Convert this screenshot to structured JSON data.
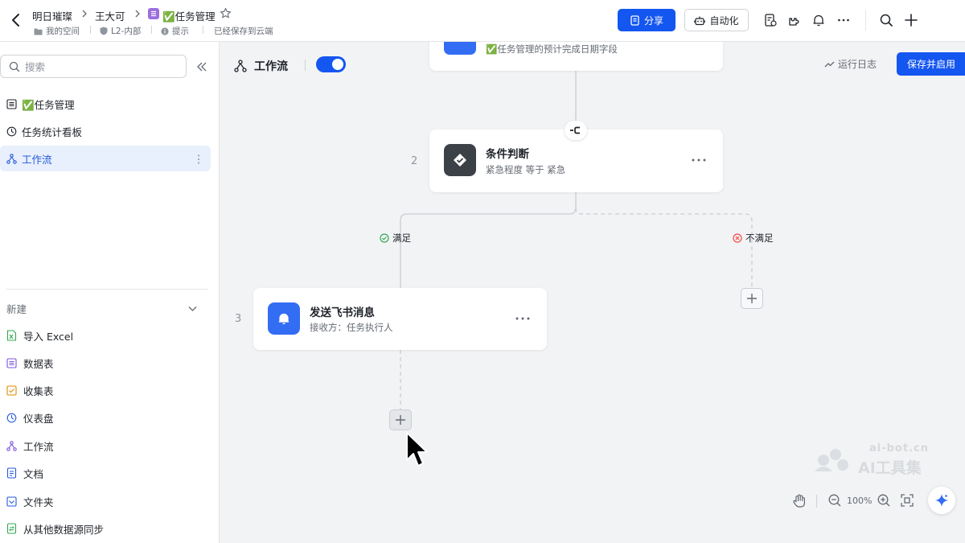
{
  "header": {
    "breadcrumbs": [
      "明日璀璨",
      "王大可",
      "✅任务管理"
    ],
    "sub": {
      "space": "我的空间",
      "level": "L2-内部",
      "tip": "提示",
      "saved": "已经保存到云端"
    },
    "share_label": "分享",
    "automation_label": "自动化"
  },
  "sidebar": {
    "search_placeholder": "搜索",
    "items": [
      {
        "label": "✅任务管理",
        "icon": "table-icon"
      },
      {
        "label": "任务统计看板",
        "icon": "dashboard-icon"
      },
      {
        "label": "工作流",
        "icon": "workflow-icon"
      }
    ],
    "new_section": {
      "title": "新建",
      "items": [
        {
          "label": "导入 Excel",
          "icon": "excel-icon"
        },
        {
          "label": "数据表",
          "icon": "table-icon"
        },
        {
          "label": "收集表",
          "icon": "form-icon"
        },
        {
          "label": "仪表盘",
          "icon": "dashboard-icon"
        },
        {
          "label": "工作流",
          "icon": "workflow-icon"
        },
        {
          "label": "文档",
          "icon": "doc-icon"
        },
        {
          "label": "文件夹",
          "icon": "folder-icon"
        },
        {
          "label": "从其他数据源同步",
          "icon": "sync-icon"
        }
      ]
    }
  },
  "workflow": {
    "title": "工作流",
    "enabled": true,
    "run_log_label": "运行日志",
    "save_enable_label": "保存并启用",
    "nodes": [
      {
        "num": "",
        "title": "",
        "sub": "✅任务管理的预计完成日期字段"
      },
      {
        "num": "2",
        "title": "条件判断",
        "sub": "紧急程度 等于 紧急"
      },
      {
        "num": "3",
        "title": "发送飞书消息",
        "sub": "接收方：任务执行人"
      }
    ],
    "branch_yes": "满足",
    "branch_no": "不满足"
  },
  "zoom": {
    "level": "100%"
  },
  "watermark": {
    "line1": "ai-bot.cn",
    "line2": "AI工具集"
  },
  "colors": {
    "accent": "#245bdb",
    "primary_btn": "#1456f0",
    "active_bg": "#e8effd",
    "canvas_bg": "#f2f3f5"
  }
}
